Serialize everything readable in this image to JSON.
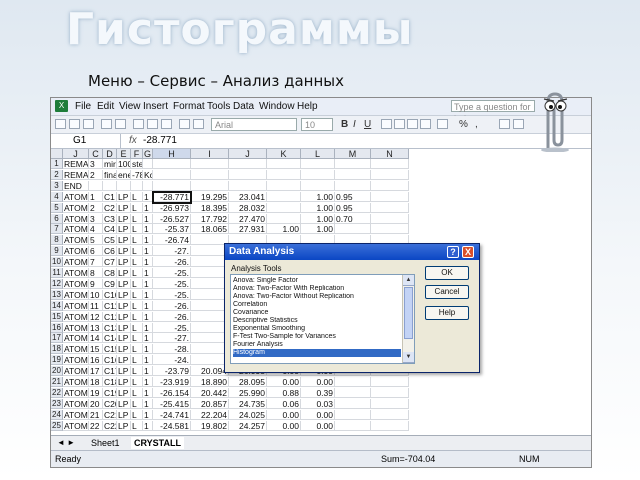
{
  "slide": {
    "title": "Гистограммы",
    "subtitle": "Меню – Сервис – Анализ данных"
  },
  "excel": {
    "menu": [
      "File",
      "Edit",
      "View",
      "Insert",
      "Format",
      "Tools",
      "Data",
      "Window",
      "Help"
    ],
    "help_placeholder": "Type a question for help",
    "font_name": "Arial",
    "font_size": "10",
    "format_buttons": [
      "B",
      "I",
      "U"
    ],
    "toolbar_right": [
      "%",
      ","
    ],
    "name_box": "G1",
    "fx": "fx",
    "formula_value": "-28.771",
    "columns": [
      "A",
      "J",
      "C",
      "D",
      "E",
      "F",
      "G",
      "H",
      "I",
      "J",
      "K",
      "L",
      "M",
      "N"
    ],
    "rows": [
      [
        "1",
        "REMARK",
        "3",
        "mirror",
        "100",
        "steps",
        "",
        "",
        "",
        "",
        "",
        "",
        "",
        ""
      ],
      [
        "2",
        "REMARK",
        "2",
        "final",
        "energy",
        "-78",
        "Kcal/mol",
        "",
        "",
        "",
        "",
        "",
        "",
        ""
      ],
      [
        "3",
        "END",
        "",
        "",
        "",
        "",
        "",
        "",
        "",
        "",
        "",
        "",
        "",
        ""
      ],
      [
        "4",
        "ATOM",
        "1",
        "C1",
        "LP",
        "L",
        "1",
        "-28.771",
        "19.295",
        "23.041",
        "",
        "1.00",
        "0.95",
        ""
      ],
      [
        "5",
        "ATOM",
        "2",
        "C2",
        "LP",
        "L",
        "1",
        "-26.973",
        "18.395",
        "28.032",
        "",
        "1.00",
        "0.95",
        ""
      ],
      [
        "6",
        "ATOM",
        "3",
        "C3",
        "LP",
        "L",
        "1",
        "-26.527",
        "17.792",
        "27.470",
        "",
        "1.00",
        "0.70",
        ""
      ],
      [
        "7",
        "ATOM",
        "4",
        "C4",
        "LP",
        "L",
        "1",
        "-25.37",
        "18.065",
        "27.931",
        "1.00",
        "1.00",
        "",
        ""
      ],
      [
        "8",
        "ATOM",
        "5",
        "C5",
        "LP",
        "L",
        "1",
        "-26.74",
        "",
        "",
        "",
        "",
        "",
        ""
      ],
      [
        "9",
        "ATOM",
        "6",
        "C6",
        "LP",
        "L",
        "1",
        "-27.",
        "",
        "",
        "",
        "",
        "",
        ""
      ],
      [
        "10",
        "ATOM",
        "7",
        "C7",
        "LP",
        "L",
        "1",
        "-26.",
        "",
        "",
        "",
        "",
        "",
        ""
      ],
      [
        "11",
        "ATOM",
        "8",
        "C8",
        "LP",
        "L",
        "1",
        "-25.",
        "",
        "",
        "",
        "",
        "",
        ""
      ],
      [
        "12",
        "ATOM",
        "9",
        "C9",
        "LP",
        "L",
        "1",
        "-25.",
        "",
        "",
        "",
        "",
        "",
        ""
      ],
      [
        "13",
        "ATOM",
        "10",
        "C10",
        "LP",
        "L",
        "1",
        "-25.",
        "",
        "",
        "",
        "",
        "",
        ""
      ],
      [
        "14",
        "ATOM",
        "11",
        "C11",
        "LP",
        "L",
        "1",
        "-26.",
        "",
        "",
        "",
        "",
        "",
        ""
      ],
      [
        "15",
        "ATOM",
        "12",
        "C12",
        "LP",
        "L",
        "1",
        "-26.",
        "",
        "",
        "",
        "",
        "",
        ""
      ],
      [
        "16",
        "ATOM",
        "13",
        "C13",
        "LP",
        "L",
        "1",
        "-25.",
        "",
        "",
        "",
        "",
        "",
        ""
      ],
      [
        "17",
        "ATOM",
        "14",
        "C14",
        "LP",
        "L",
        "1",
        "-27.",
        "",
        "",
        "",
        "",
        "",
        ""
      ],
      [
        "18",
        "ATOM",
        "15",
        "C15",
        "LP",
        "L",
        "1",
        "-28.",
        "",
        "",
        "",
        "",
        "",
        ""
      ],
      [
        "19",
        "ATOM",
        "16",
        "C16",
        "LP",
        "L",
        "1",
        "-24.",
        "",
        "",
        "",
        "",
        "",
        ""
      ],
      [
        "20",
        "ATOM",
        "17",
        "C17",
        "LP",
        "L",
        "1",
        "-23.79",
        "20.094",
        "26.995",
        "0.00",
        "0.00",
        "",
        ""
      ],
      [
        "21",
        "ATOM",
        "18",
        "C18",
        "LP",
        "L",
        "1",
        "-23.919",
        "18.890",
        "28.095",
        "0.00",
        "0.00",
        "",
        ""
      ],
      [
        "22",
        "ATOM",
        "19",
        "C19",
        "LP",
        "L",
        "1",
        "-26.154",
        "20.442",
        "25.990",
        "0.88",
        "0.39",
        "",
        ""
      ],
      [
        "23",
        "ATOM",
        "20",
        "C20",
        "LP",
        "L",
        "1",
        "-25.415",
        "20.857",
        "24.735",
        "0.06",
        "0.03",
        "",
        ""
      ],
      [
        "24",
        "ATOM",
        "21",
        "C21",
        "LP",
        "L",
        "1",
        "-24.741",
        "22.204",
        "24.025",
        "0.00",
        "0.00",
        "",
        ""
      ],
      [
        "25",
        "ATOM",
        "22",
        "C22",
        "LP",
        "L",
        "1",
        "-24.581",
        "19.802",
        "24.257",
        "0.00",
        "0.00",
        "",
        ""
      ]
    ],
    "sheet_tabs": [
      "Sheet1",
      "CRYSTALL"
    ],
    "status_ready": "Ready",
    "status_sum": "Sum=-704.04",
    "status_num": "NUM"
  },
  "dialog": {
    "title": "Data Analysis",
    "help_icon": "?",
    "close_icon": "X",
    "tools_label": "Analysis Tools",
    "tools": [
      "Anova: Single Factor",
      "Anova: Two-Factor With Replication",
      "Anova: Two-Factor Without Replication",
      "Correlation",
      "Covariance",
      "Descriptive Statistics",
      "Exponential Smoothing",
      "F-Test Two-Sample for Variances",
      "Fourier Analysis",
      "Histogram"
    ],
    "selected_tool": "Histogram",
    "ok_label": "OK",
    "cancel_label": "Cancel",
    "help_label": "Help"
  },
  "colors": {
    "selection": "#316ac5",
    "title_bar": "#0a46c4",
    "excel_green": "#1e7d3a"
  }
}
